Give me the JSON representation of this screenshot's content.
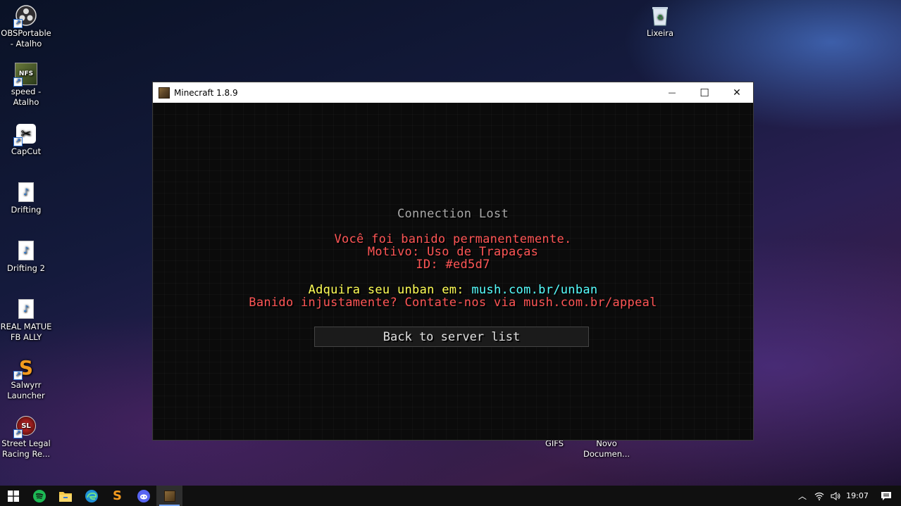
{
  "desktop": {
    "icons_left": [
      {
        "label": "OBSPortable - Atalho",
        "icon": "obs-icon"
      },
      {
        "label": "speed - Atalho",
        "icon": "nfs-icon"
      },
      {
        "label": "CapCut",
        "icon": "capcut-icon"
      },
      {
        "label": "Drifting",
        "icon": "mp3-file-icon"
      },
      {
        "label": "Drifting 2",
        "icon": "mp3-file-icon"
      },
      {
        "label": "REAL MATUE FB ALLY",
        "icon": "mp3-file-icon"
      },
      {
        "label": "Salwyrr Launcher",
        "icon": "salwyrr-icon"
      },
      {
        "label": "Street Legal Racing Re...",
        "icon": "slrr-icon"
      }
    ],
    "recycle_bin": {
      "label": "Lixeira",
      "icon": "recycle-bin-icon"
    },
    "gifs": {
      "label": "GIFS"
    },
    "novo_doc": {
      "label": "Novo Documen..."
    }
  },
  "window": {
    "title": "Minecraft 1.8.9",
    "minimize_symbol": "—",
    "maximize_symbol": "☐",
    "close_symbol": "✕"
  },
  "game": {
    "heading": "Connection Lost",
    "ban_line1": "Você foi banido permanentemente.",
    "ban_line2": "Motivo: Uso de Trapaças",
    "ban_line3": "ID: #ed5d7",
    "unban_prefix": "Adquira seu unban em: ",
    "unban_link": "mush.com.br/unban",
    "appeal": "Banido injustamente? Contate-nos via mush.com.br/appeal",
    "back_button": "Back to server list",
    "colors": {
      "heading": "#a8a8a8",
      "red": "#ff5555",
      "yellow": "#ffff55",
      "aqua": "#55ffff"
    }
  },
  "taskbar": {
    "apps": [
      "windows-start-icon",
      "spotify-icon",
      "file-explorer-icon",
      "edge-icon",
      "salwyrr-icon",
      "discord-icon",
      "minecraft-icon"
    ],
    "clock": "19:07"
  }
}
